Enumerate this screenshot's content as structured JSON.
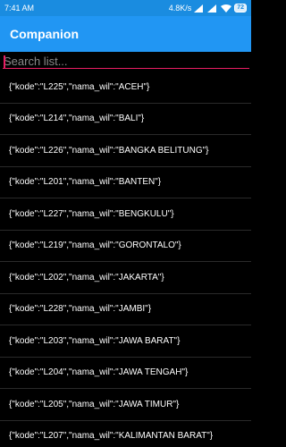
{
  "status_bar": {
    "time": "7:41 AM",
    "speed": "4.8K/s",
    "battery": "72"
  },
  "app_bar": {
    "title": "Companion"
  },
  "search": {
    "placeholder": "Search list..."
  },
  "list": {
    "items": [
      "{\"kode\":\"L225\",\"nama_wil\":\"ACEH\"}",
      "{\"kode\":\"L214\",\"nama_wil\":\"BALI\"}",
      "{\"kode\":\"L226\",\"nama_wil\":\"BANGKA BELITUNG\"}",
      "{\"kode\":\"L201\",\"nama_wil\":\"BANTEN\"}",
      "{\"kode\":\"L227\",\"nama_wil\":\"BENGKULU\"}",
      "{\"kode\":\"L219\",\"nama_wil\":\"GORONTALO\"}",
      "{\"kode\":\"L202\",\"nama_wil\":\"JAKARTA\"}",
      "{\"kode\":\"L228\",\"nama_wil\":\"JAMBI\"}",
      "{\"kode\":\"L203\",\"nama_wil\":\"JAWA BARAT\"}",
      "{\"kode\":\"L204\",\"nama_wil\":\"JAWA TENGAH\"}",
      "{\"kode\":\"L205\",\"nama_wil\":\"JAWA TIMUR\"}",
      "{\"kode\":\"L207\",\"nama_wil\":\"KALIMANTAN BARAT\"}"
    ]
  },
  "colors": {
    "status_bar": "#1a8ce0",
    "app_bar": "#2196f3",
    "accent": "#e91e63",
    "background": "#000000"
  }
}
